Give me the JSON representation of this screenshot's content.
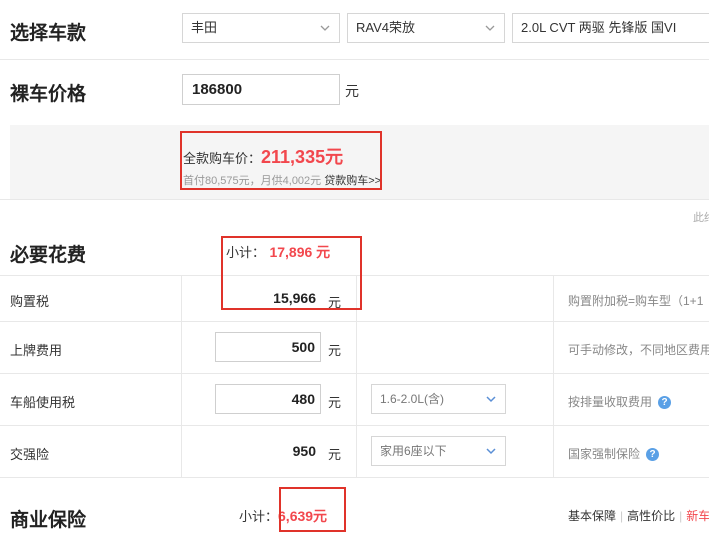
{
  "sections": {
    "select_model": "选择车款",
    "bare_price": "裸车价格",
    "required_fees": "必要花费",
    "commercial_insurance": "商业保险"
  },
  "selects": {
    "brand": "丰田",
    "series": "RAV4荣放",
    "model": "2.0L CVT 两驱 先锋版 国VI"
  },
  "bare_price": {
    "value": "186800",
    "unit": "元"
  },
  "total": {
    "label": "全款购车价：",
    "amount": "211,335元",
    "loan_line": "首付80,575元，月供4,002元",
    "loan_link": "贷款购车>>"
  },
  "side_cut_text": "此终",
  "required": {
    "subtotal_label": "小计：",
    "subtotal_value": "17,896 元",
    "rows": [
      {
        "label": "购置税",
        "value": "15,966",
        "unit": "元",
        "note": "购置附加税=购车型（1+1"
      },
      {
        "label": "上牌费用",
        "value": "500",
        "unit": "元",
        "note": "可手动修改，不同地区费用"
      },
      {
        "label": "车船使用税",
        "value": "480",
        "unit": "元",
        "select": "1.6-2.0L(含)",
        "note": "按排量收取费用"
      },
      {
        "label": "交强险",
        "value": "950",
        "unit": "元",
        "select": "家用6座以下",
        "note": "国家强制保险"
      }
    ]
  },
  "commercial": {
    "subtotal_label": "小计：",
    "subtotal_value": "6,639元",
    "tabs": [
      "基本保障",
      "高性价比",
      "新车"
    ]
  },
  "colors": {
    "accent_red": "#e0332a",
    "price_red": "#f2474d",
    "help_blue": "#5aa0e6"
  }
}
